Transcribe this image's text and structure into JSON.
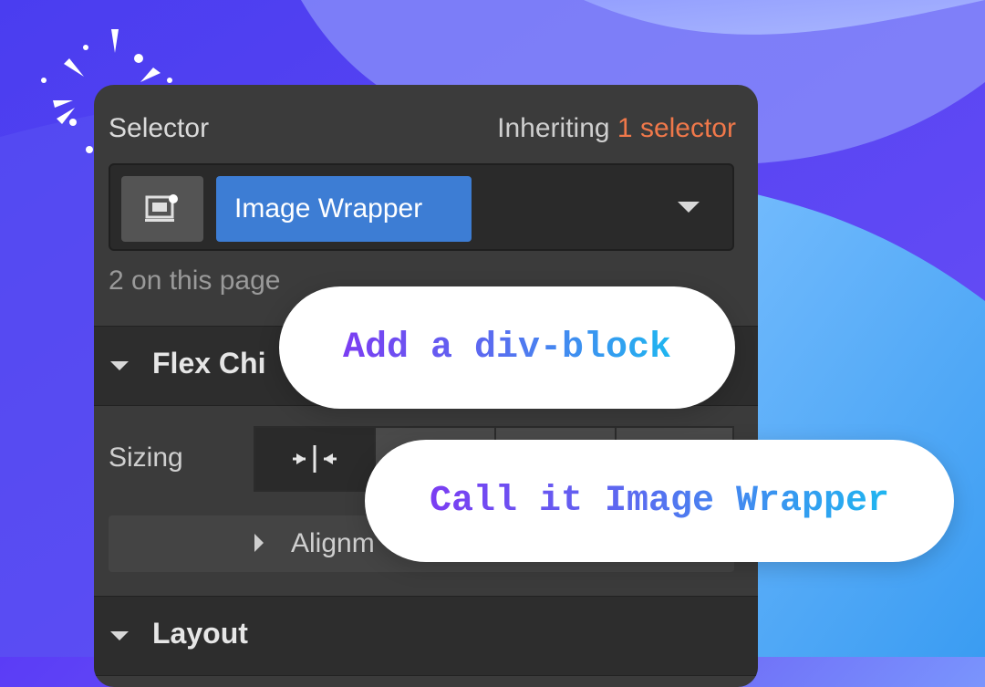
{
  "selector_panel": {
    "label": "Selector",
    "inheriting_text": "Inheriting",
    "inheriting_count": "1 selector",
    "selected_tag": "Image Wrapper",
    "page_count": "2 on this page"
  },
  "sections": {
    "flex_child": "Flex Chi",
    "sizing_label": "Sizing",
    "alignment": "Alignm",
    "layout": "Layout"
  },
  "callouts": {
    "first": "Add a div-block",
    "second": "Call it Image Wrapper"
  },
  "colors": {
    "accent_orange": "#f0784a",
    "tag_blue": "#3d7dd4",
    "panel_bg": "#3b3b3b"
  },
  "icons": {
    "selector_type": "element-icon",
    "dropdown": "chevron-down-icon",
    "sizing_shrink": "shrink-icon"
  }
}
